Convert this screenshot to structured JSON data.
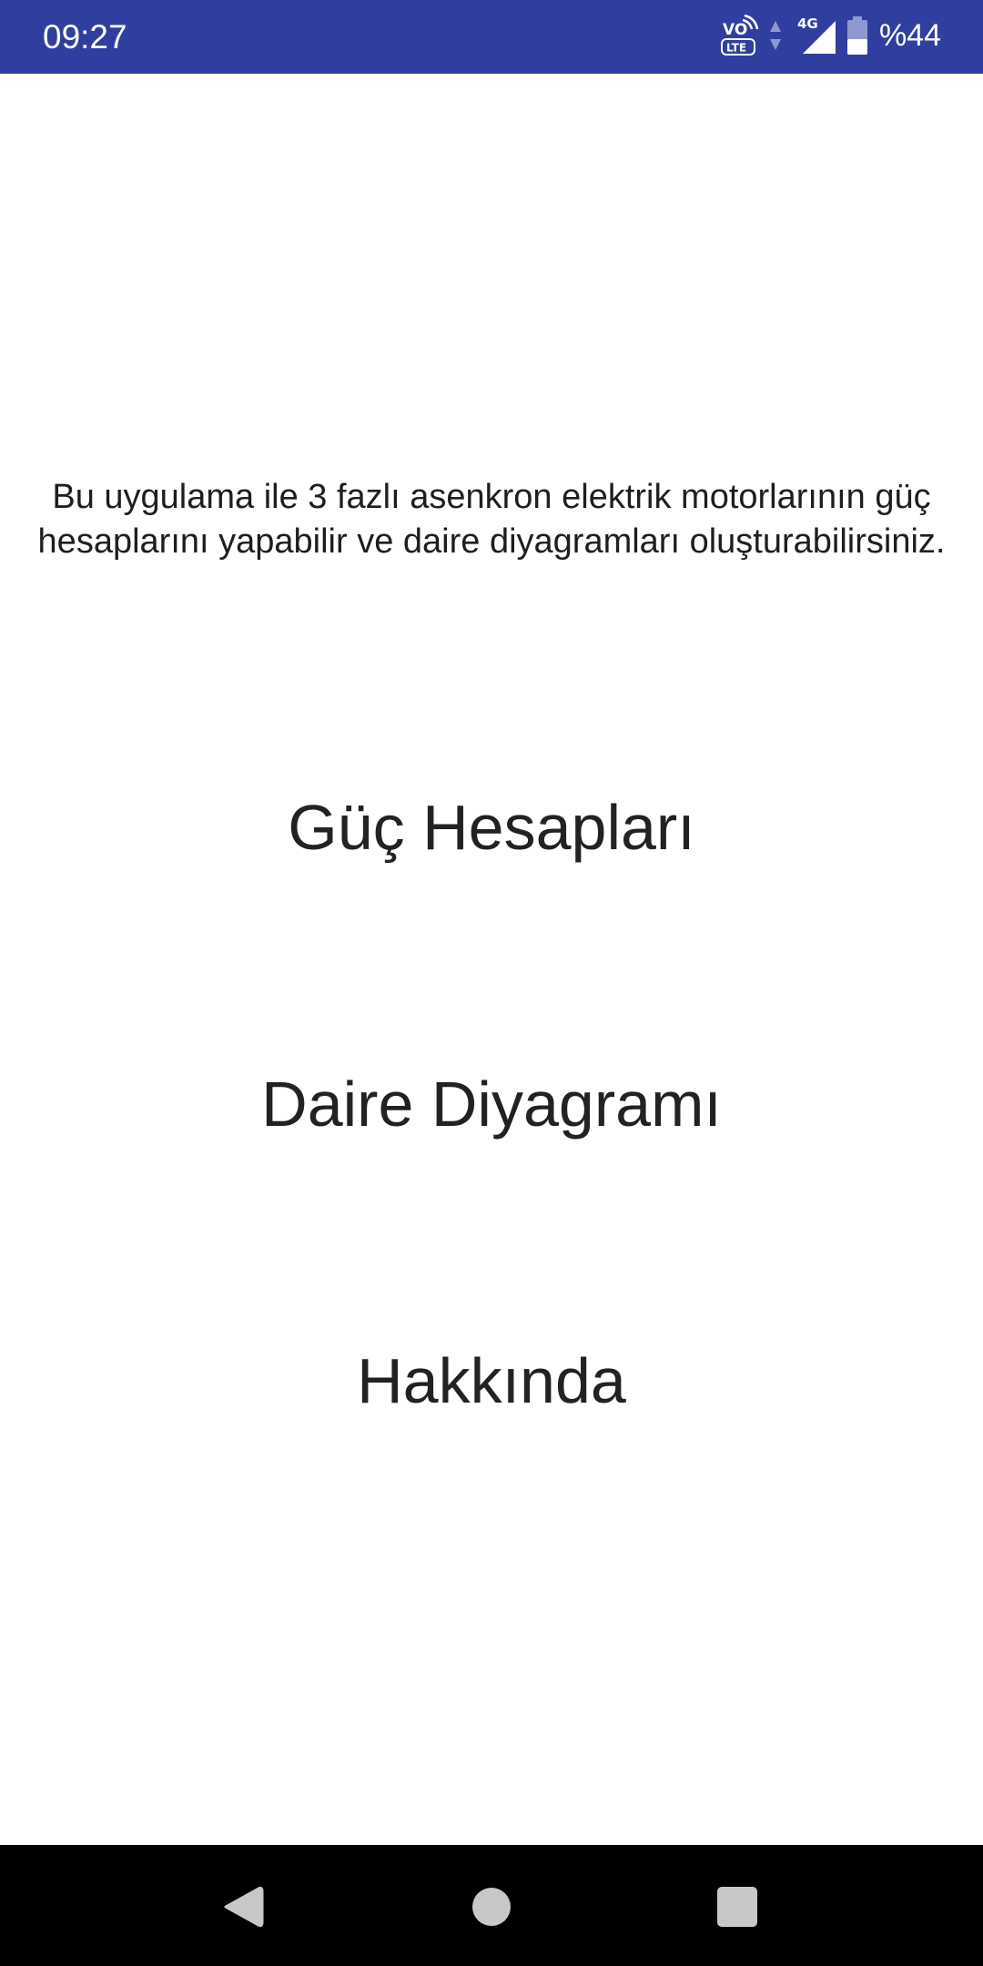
{
  "status_bar": {
    "time": "09:27",
    "volte_top": "VO",
    "volte_bottom": "LTE",
    "network_type": "4G",
    "battery_percent": "%44",
    "battery_level": 0.44,
    "background_color": "#303f9f"
  },
  "main": {
    "description": "Bu uygulama ile 3 fazlı asenkron elektrik motorlarının güç hesaplarını yapabilir ve daire diyagramları oluşturabilirsiniz.",
    "buttons": {
      "power_calc": "Güç Hesapları",
      "circle_diagram": "Daire Diyagramı",
      "about": "Hakkında"
    }
  },
  "nav_bar": {
    "icons": [
      "back-icon",
      "home-icon",
      "recent-apps-icon"
    ]
  }
}
